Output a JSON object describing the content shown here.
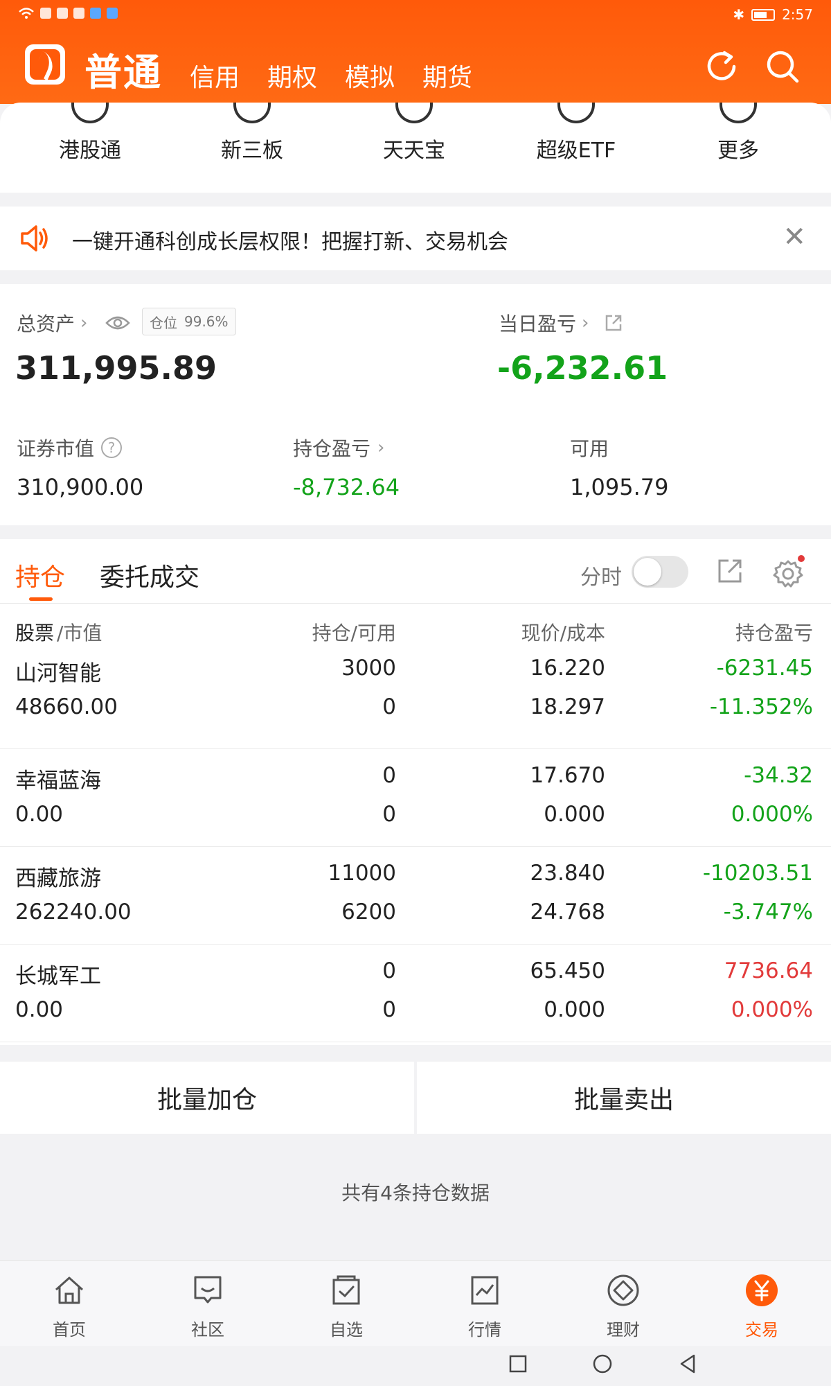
{
  "status_bar": {
    "time": "2:57"
  },
  "header": {
    "main_tab": "普通",
    "tabs": [
      "信用",
      "期权",
      "模拟",
      "期货"
    ]
  },
  "quick_entries": [
    "港股通",
    "新三板",
    "天天宝",
    "超级ETF",
    "更多"
  ],
  "notice": {
    "text": "一键开通科创成长层权限！把握打新、交易机会"
  },
  "assets": {
    "total_label": "总资产",
    "position_label": "仓位",
    "position_value": "99.6%",
    "total_value": "311,995.89",
    "daily_label": "当日盈亏",
    "daily_value": "-6,232.61",
    "market_label": "证券市值",
    "market_value": "310,900.00",
    "holding_pl_label": "持仓盈亏",
    "holding_pl_value": "-8,732.64",
    "available_label": "可用",
    "available_value": "1,095.79"
  },
  "positions": {
    "tab_active": "持仓",
    "tab_other": "委托成交",
    "fenshi_label": "分时",
    "columns": {
      "stock": "股票",
      "stock_sub": "/市值",
      "holding": "持仓/可用",
      "price": "现价/成本",
      "pl": "持仓盈亏"
    },
    "rows": [
      {
        "name": "山河智能",
        "mv": "48660.00",
        "hold": "3000",
        "avail": "0",
        "price": "16.220",
        "cost": "18.297",
        "pl": "-6231.45",
        "pct": "-11.352%",
        "dir": "down"
      },
      {
        "name": "幸福蓝海",
        "mv": "0.00",
        "hold": "0",
        "avail": "0",
        "price": "17.670",
        "cost": "0.000",
        "pl": "-34.32",
        "pct": "0.000%",
        "dir": "down"
      },
      {
        "name": "西藏旅游",
        "mv": "262240.00",
        "hold": "11000",
        "avail": "6200",
        "price": "23.840",
        "cost": "24.768",
        "pl": "-10203.51",
        "pct": "-3.747%",
        "dir": "down"
      },
      {
        "name": "长城军工",
        "mv": "0.00",
        "hold": "0",
        "avail": "0",
        "price": "65.450",
        "cost": "0.000",
        "pl": "7736.64",
        "pct": "0.000%",
        "dir": "up"
      }
    ]
  },
  "batch": {
    "add": "批量加仓",
    "sell": "批量卖出"
  },
  "summary": "共有4条持仓数据",
  "bottom_nav": [
    {
      "label": "首页",
      "icon": "home-icon"
    },
    {
      "label": "社区",
      "icon": "community-icon"
    },
    {
      "label": "自选",
      "icon": "watchlist-icon"
    },
    {
      "label": "行情",
      "icon": "market-icon"
    },
    {
      "label": "理财",
      "icon": "wealth-icon"
    },
    {
      "label": "交易",
      "icon": "trade-icon",
      "active": true
    }
  ],
  "colors": {
    "brand": "#ff5a0a",
    "gain": "#e23a3a",
    "loss": "#13a31a"
  }
}
